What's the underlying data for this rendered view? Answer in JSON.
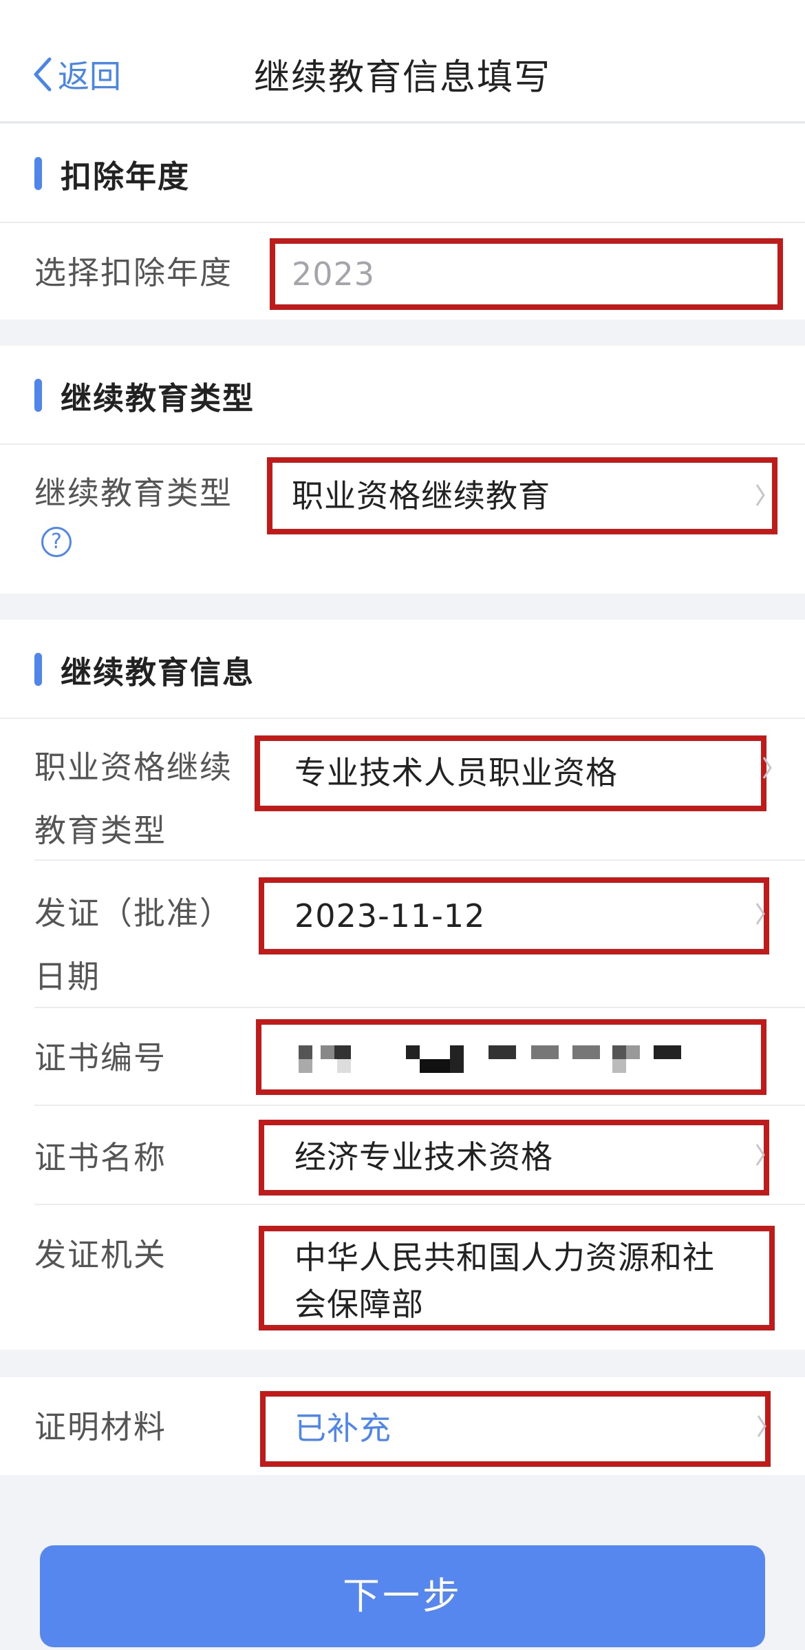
{
  "navbar": {
    "back_label": "返回",
    "title": "继续教育信息填写"
  },
  "year_section": {
    "title": "扣除年度",
    "label": "选择扣除年度",
    "value": "2023"
  },
  "type_section": {
    "title": "继续教育类型",
    "label": "继续教育类型",
    "help": "?",
    "value": "职业资格继续教育"
  },
  "info_section": {
    "title": "继续教育信息",
    "qual_type_label_line1": "职业资格继续",
    "qual_type_label_line2": "教育类型",
    "qual_type_value": "专业技术人员职业资格",
    "issue_date_label_line1": "发证（批准）",
    "issue_date_label_line2": "日期",
    "issue_date_value": "2023-11-12",
    "cert_number_label": "证书编号",
    "cert_name_label": "证书名称",
    "cert_name_value": "经济专业技术资格",
    "issuer_label": "发证机关",
    "issuer_value_line1": "中华人民共和国人力资源和社",
    "issuer_value_line2": "会保障部"
  },
  "proof_section": {
    "label": "证明材料",
    "value": "已补充"
  },
  "footer": {
    "next_label": "下一步"
  },
  "colors": {
    "accent": "#4f86ee",
    "highlight_box": "#c01b1b",
    "button": "#5587ee"
  }
}
